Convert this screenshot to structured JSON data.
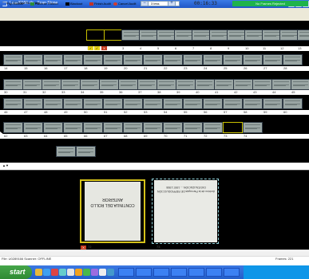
{
  "window": {
    "title": "U0289166.rib - Scan Stone",
    "buttons": {
      "minimize": "_",
      "maximize": "□",
      "close": "×"
    }
  },
  "menu": {
    "file": "File",
    "edit": "Edit",
    "view": "View",
    "tools": "Tools",
    "help": "Help"
  },
  "toolbar": {
    "flip_ribbon": "Flip Ribbon",
    "reverse_ribbon": "Reverse Ribbon",
    "blackout": "Blackout",
    "finish_audit": "Finish Audit",
    "cancel_audit": "Cancel Audit",
    "zoom_value": "3 less",
    "timer": "00:16:33",
    "status": "No Frames Rejected"
  },
  "thumbnails": {
    "row1_numbers": [
      "1",
      "2",
      "3",
      "4",
      "5",
      "6",
      "7",
      "8",
      "9",
      "10",
      "11",
      "12",
      "13"
    ],
    "row2_numbers": [
      "14",
      "15",
      "16",
      "17",
      "18",
      "19",
      "20",
      "21",
      "22",
      "23",
      "24",
      "25",
      "26",
      "27",
      "28"
    ],
    "row3_numbers": [
      "30",
      "31",
      "32",
      "33",
      "34",
      "35",
      "36",
      "37",
      "38",
      "39",
      "40",
      "41",
      "42",
      "43",
      "44",
      "45"
    ],
    "row4_numbers": [
      "46",
      "47",
      "48",
      "49",
      "50",
      "51",
      "52",
      "53",
      "54",
      "55",
      "56",
      "57",
      "58",
      "59",
      "60"
    ],
    "row5_numbers": [
      "62",
      "63",
      "64",
      "65",
      "66",
      "67",
      "68",
      "69",
      "70",
      "71",
      "72",
      "73",
      "74"
    ]
  },
  "preview": {
    "left_label": "72",
    "right_label": "73",
    "left_text": "CONTINUA DEL ROLLO ANTERIOR",
    "right_text": "Archivo de la Parroquia DE REPRODUCCIÓN DIGITALIZACIÓN ... 1957-1958"
  },
  "statusbar": {
    "left": "File: U0289166   Scanner: OFFLINE",
    "right": "Frames: 221"
  },
  "taskbar": {
    "start": "start"
  }
}
